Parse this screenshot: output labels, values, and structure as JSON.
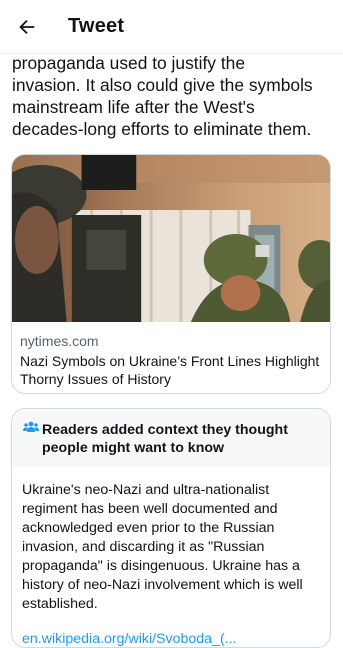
{
  "header": {
    "title": "Tweet",
    "back_icon": "arrow-left-icon"
  },
  "tweet": {
    "lines": [
      "propaganda used to justify the",
      "invasion. It also could give the symbols",
      "mainstream life after the West's",
      "decades-long efforts to eliminate them."
    ]
  },
  "card": {
    "domain": "nytimes.com",
    "title": "Nazi Symbols on Ukraine’s Front Lines Highlight Thorny Issues of History"
  },
  "note": {
    "icon": "people-icon",
    "title": "Readers added context they thought people might want to know",
    "body_lines": [
      "Ukraine's neo-Nazi and ultra-nationalist",
      "regiment has been well documented and",
      "acknowledged even prior to the Russian",
      "invasion, and discarding it as \"Russian",
      "propaganda\" is disingenuous. Ukraine has a",
      "history of neo-Nazi involvement which is well",
      "established."
    ],
    "link": "en.wikipedia.org/wiki/Svoboda_(..."
  },
  "colors": {
    "text": "#0f1419",
    "secondary": "#536471",
    "link": "#1d9bf0",
    "border": "#cfd9de",
    "note_header_bg": "#f7f9f9"
  }
}
